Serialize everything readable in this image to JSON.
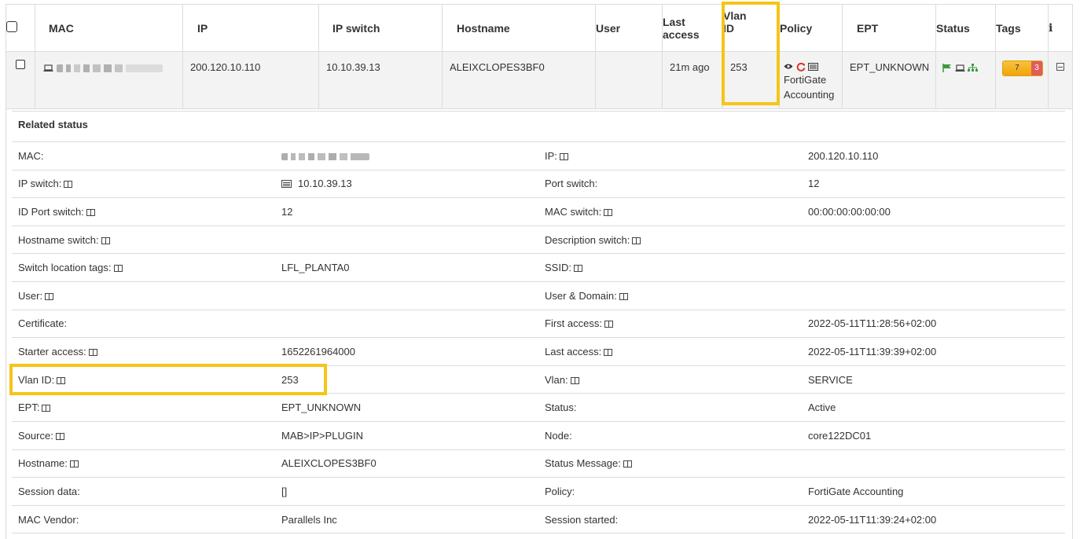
{
  "table": {
    "headers": [
      "MAC",
      "IP",
      "IP switch",
      "Hostname",
      "User",
      "Last access",
      "Vlan ID",
      "Policy",
      "EPT",
      "Status",
      "Tags",
      "i"
    ],
    "header_last_access_line1": "Last",
    "header_last_access_line2": "access",
    "header_vlan_line1": "Vlan",
    "header_vlan_line2": "ID",
    "row": {
      "ip": "200.120.10.110",
      "ip_switch": "10.10.39.13",
      "hostname": "ALEIXCLOPES3BF0",
      "user": "",
      "last_access": "21m ago",
      "vlan_id": "253",
      "policy_line1": "FortiGate",
      "policy_line2": "Accounting",
      "ept": "EPT_UNKNOWN",
      "tag_yellow": "7",
      "tag_red": "3"
    }
  },
  "related": {
    "title": "Related status",
    "rows": [
      {
        "l1": "MAC:",
        "v1": "",
        "l2": "IP:",
        "v2": "200.120.10.110"
      },
      {
        "l1": "IP switch:",
        "v1": "10.10.39.13",
        "l2": "Port switch:",
        "v2": "12"
      },
      {
        "l1": "ID Port switch:",
        "v1": "12",
        "l2": "MAC switch:",
        "v2": "00:00:00:00:00:00"
      },
      {
        "l1": "Hostname switch:",
        "v1": "",
        "l2": "Description switch:",
        "v2": ""
      },
      {
        "l1": "Switch location tags:",
        "v1": "LFL_PLANTA0",
        "l2": "SSID:",
        "v2": ""
      },
      {
        "l1": "User:",
        "v1": "",
        "l2": "User & Domain:",
        "v2": ""
      },
      {
        "l1": "Certificate:",
        "v1": "",
        "l2": "First access:",
        "v2": "2022-05-11T11:28:56+02:00"
      },
      {
        "l1": "Starter access:",
        "v1": "1652261964000",
        "l2": "Last access:",
        "v2": "2022-05-11T11:39:39+02:00"
      },
      {
        "l1": "Vlan ID:",
        "v1": "253",
        "l2": "Vlan:",
        "v2": "SERVICE"
      },
      {
        "l1": "EPT:",
        "v1": "EPT_UNKNOWN",
        "l2": "Status:",
        "v2": "Active"
      },
      {
        "l1": "Source:",
        "v1": "MAB>IP>PLUGIN",
        "l2": "Node:",
        "v2": "core122DC01"
      },
      {
        "l1": "Hostname:",
        "v1": "ALEIXCLOPES3BF0",
        "l2": "Status Message:",
        "v2": ""
      },
      {
        "l1": "Session data:",
        "v1": "[]",
        "l2": "Policy:",
        "v2": "FortiGate Accounting"
      },
      {
        "l1": "MAC Vendor:",
        "v1": "Parallels Inc",
        "l2": "Session started:",
        "v2": "2022-05-11T11:39:24+02:00"
      }
    ]
  },
  "colors": {
    "highlight": "#f5c518",
    "status_flag": "#3a9a3a",
    "network_icon": "#3a9a3a",
    "refresh_icon": "#d9342b",
    "tag_yellow": "#f0a30a",
    "tag_red": "#e25c5c"
  },
  "icons": [
    "checkbox",
    "laptop-icon",
    "eye-icon",
    "refresh-icon",
    "list-icon",
    "flag-icon",
    "network-icon",
    "info-icon",
    "collapse-icon",
    "column-icon",
    "switch-icon"
  ]
}
